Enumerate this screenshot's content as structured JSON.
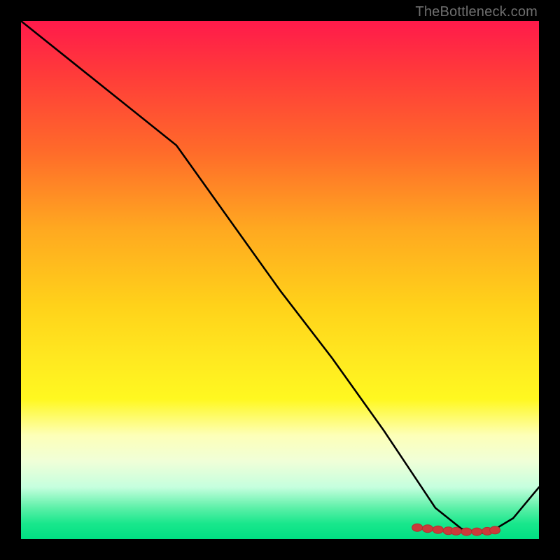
{
  "attribution": "TheBottleneck.com",
  "colors": {
    "frame": "#000000",
    "line": "#000000",
    "marker_fill": "#cc3a3a",
    "marker_stroke": "#b23030"
  },
  "chart_data": {
    "type": "line",
    "title": "",
    "xlabel": "",
    "ylabel": "",
    "xlim": [
      0,
      100
    ],
    "ylim": [
      0,
      100
    ],
    "grid": false,
    "legend": false,
    "series": [
      {
        "name": "curve",
        "x": [
          0,
          10,
          20,
          30,
          40,
          50,
          60,
          70,
          76,
          80,
          85,
          90,
          95,
          100
        ],
        "y": [
          100,
          92,
          84,
          76,
          62,
          48,
          35,
          21,
          12,
          6,
          2,
          1,
          4,
          10
        ]
      }
    ],
    "markers": {
      "name": "highlight-cluster",
      "x": [
        76.5,
        78.5,
        80.5,
        82.5,
        84.0,
        86.0,
        88.0,
        90.0,
        91.5
      ],
      "y": [
        2.2,
        2.0,
        1.8,
        1.6,
        1.5,
        1.4,
        1.4,
        1.5,
        1.7
      ]
    }
  }
}
